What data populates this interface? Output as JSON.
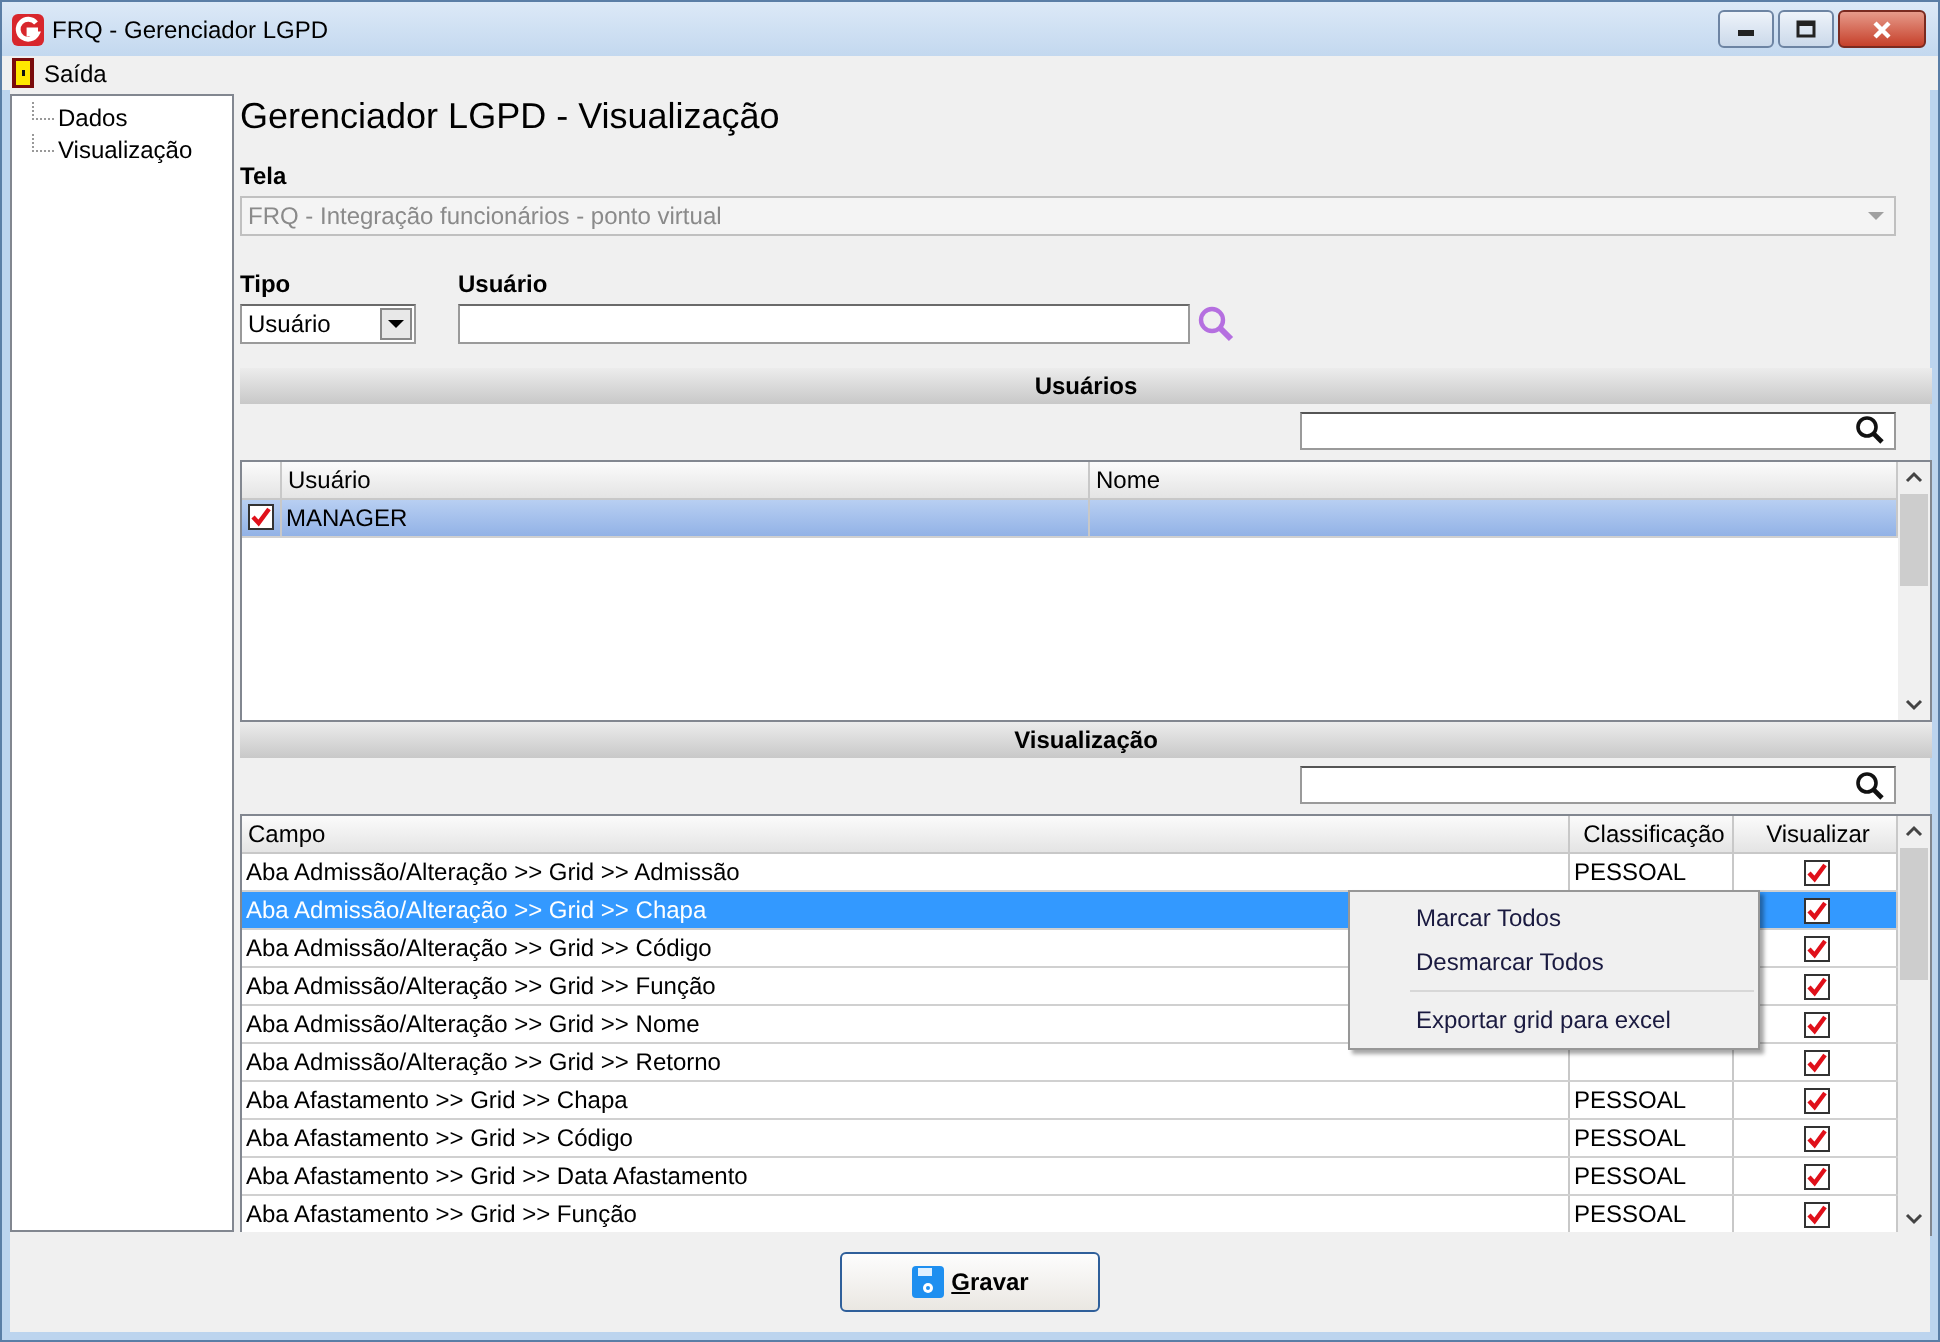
{
  "window": {
    "title": "FRQ - Gerenciador LGPD"
  },
  "menu": [
    {
      "label": "Saída"
    }
  ],
  "tree": {
    "items": [
      {
        "label": "Dados"
      },
      {
        "label": "Visualização"
      }
    ]
  },
  "heading": "Gerenciador LGPD - Visualização",
  "tela": {
    "label": "Tela",
    "value": "FRQ - Integração funcionários - ponto virtual",
    "disabled": true
  },
  "tipo": {
    "label": "Tipo",
    "value": "Usuário"
  },
  "usuario": {
    "label": "Usuário"
  },
  "users_section": {
    "title": "Usuários",
    "columns": [
      "Usuário",
      "Nome"
    ],
    "rows": [
      {
        "checked": true,
        "selected": true,
        "usuario": "MANAGER"
      }
    ]
  },
  "view_section": {
    "title": "Visualização",
    "columns": [
      "Campo",
      "Classificação",
      "Visualizar"
    ],
    "rows": [
      {
        "campo": "Aba Admissão/Alteração >> Grid >> Admissão",
        "classificacao": "PESSOAL",
        "visualizar": true,
        "selected": false
      },
      {
        "campo": "Aba Admissão/Alteração >> Grid >> Chapa",
        "visualizar": true,
        "selected": true
      },
      {
        "campo": "Aba Admissão/Alteração >> Grid >> Código",
        "visualizar": true,
        "selected": false
      },
      {
        "campo": "Aba Admissão/Alteração >> Grid >> Função",
        "visualizar": true,
        "selected": false
      },
      {
        "campo": "Aba Admissão/Alteração >> Grid >> Nome",
        "visualizar": true,
        "selected": false
      },
      {
        "campo": "Aba Admissão/Alteração >> Grid >> Retorno",
        "visualizar": true,
        "selected": false
      },
      {
        "campo": "Aba Afastamento >> Grid >> Chapa",
        "classificacao": "PESSOAL",
        "visualizar": true,
        "selected": false
      },
      {
        "campo": "Aba Afastamento >> Grid >> Código",
        "classificacao": "PESSOAL",
        "visualizar": true,
        "selected": false
      },
      {
        "campo": "Aba Afastamento >> Grid >> Data Afastamento",
        "classificacao": "PESSOAL",
        "visualizar": true,
        "selected": false
      },
      {
        "campo": "Aba Afastamento >> Grid >> Função",
        "classificacao": "PESSOAL",
        "visualizar": true,
        "selected": false
      }
    ]
  },
  "context_menu": {
    "items": [
      {
        "kind": "item",
        "label": "Marcar Todos"
      },
      {
        "kind": "item",
        "label": "Desmarcar Todos"
      },
      {
        "kind": "separator"
      },
      {
        "kind": "item",
        "label": "Exportar grid para excel"
      }
    ]
  },
  "save_button": {
    "label": "Gravar"
  }
}
